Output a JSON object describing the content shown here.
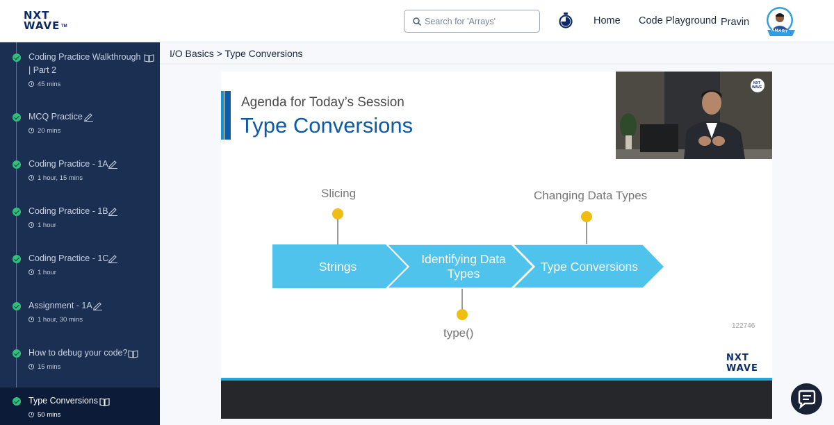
{
  "header": {
    "logo_line1": "NXT",
    "logo_line2": "WAVE",
    "logo_tm": "TM",
    "search_placeholder": "Search for 'Arrays'",
    "nav": {
      "home": "Home",
      "playground": "Code Playground",
      "user": "Pravin"
    },
    "avatar_badge": "SMART"
  },
  "sidebar": {
    "items": [
      {
        "title1": "Coding Practice Walkthrough",
        "title2": "| Part 2",
        "duration": "45 mins",
        "icon": "book-icon"
      },
      {
        "title1": "MCQ Practice",
        "duration": "20 mins",
        "icon": "pencil-icon"
      },
      {
        "title1": "Coding Practice - 1A",
        "duration": "1 hour, 15 mins",
        "icon": "pencil-icon"
      },
      {
        "title1": "Coding Practice - 1B",
        "duration": "1 hour",
        "icon": "pencil-icon"
      },
      {
        "title1": "Coding Practice - 1C",
        "duration": "1 hour",
        "icon": "pencil-icon"
      },
      {
        "title1": "Assignment - 1A",
        "duration": "1 hour, 30 mins",
        "icon": "pencil-icon"
      },
      {
        "title1": "How to debug your code?",
        "duration": "15 mins",
        "icon": "book-icon"
      },
      {
        "title1": "Type Conversions",
        "duration": "50 mins",
        "icon": "book-icon",
        "active": true
      }
    ]
  },
  "breadcrumb": "I/O Basics > Type Conversions",
  "slide": {
    "agenda": "Agenda for Today’s Session",
    "title": "Type Conversions",
    "arrows": [
      "Strings",
      "Identifying Data Types",
      "Type Conversions"
    ],
    "label_top_1": "Slicing",
    "label_top_2": "Changing Data Types",
    "label_bottom": "type()",
    "watermark": "122746",
    "logo_line1": "NXT",
    "logo_line2": "WAVE",
    "cam_logo_1": "NXT",
    "cam_logo_2": "WAVE"
  },
  "colors": {
    "sidebar": "#1b2f52",
    "accent_blue": "#4fc3ec",
    "pin": "#f0be12",
    "title_blue": "#0d5aa7"
  }
}
